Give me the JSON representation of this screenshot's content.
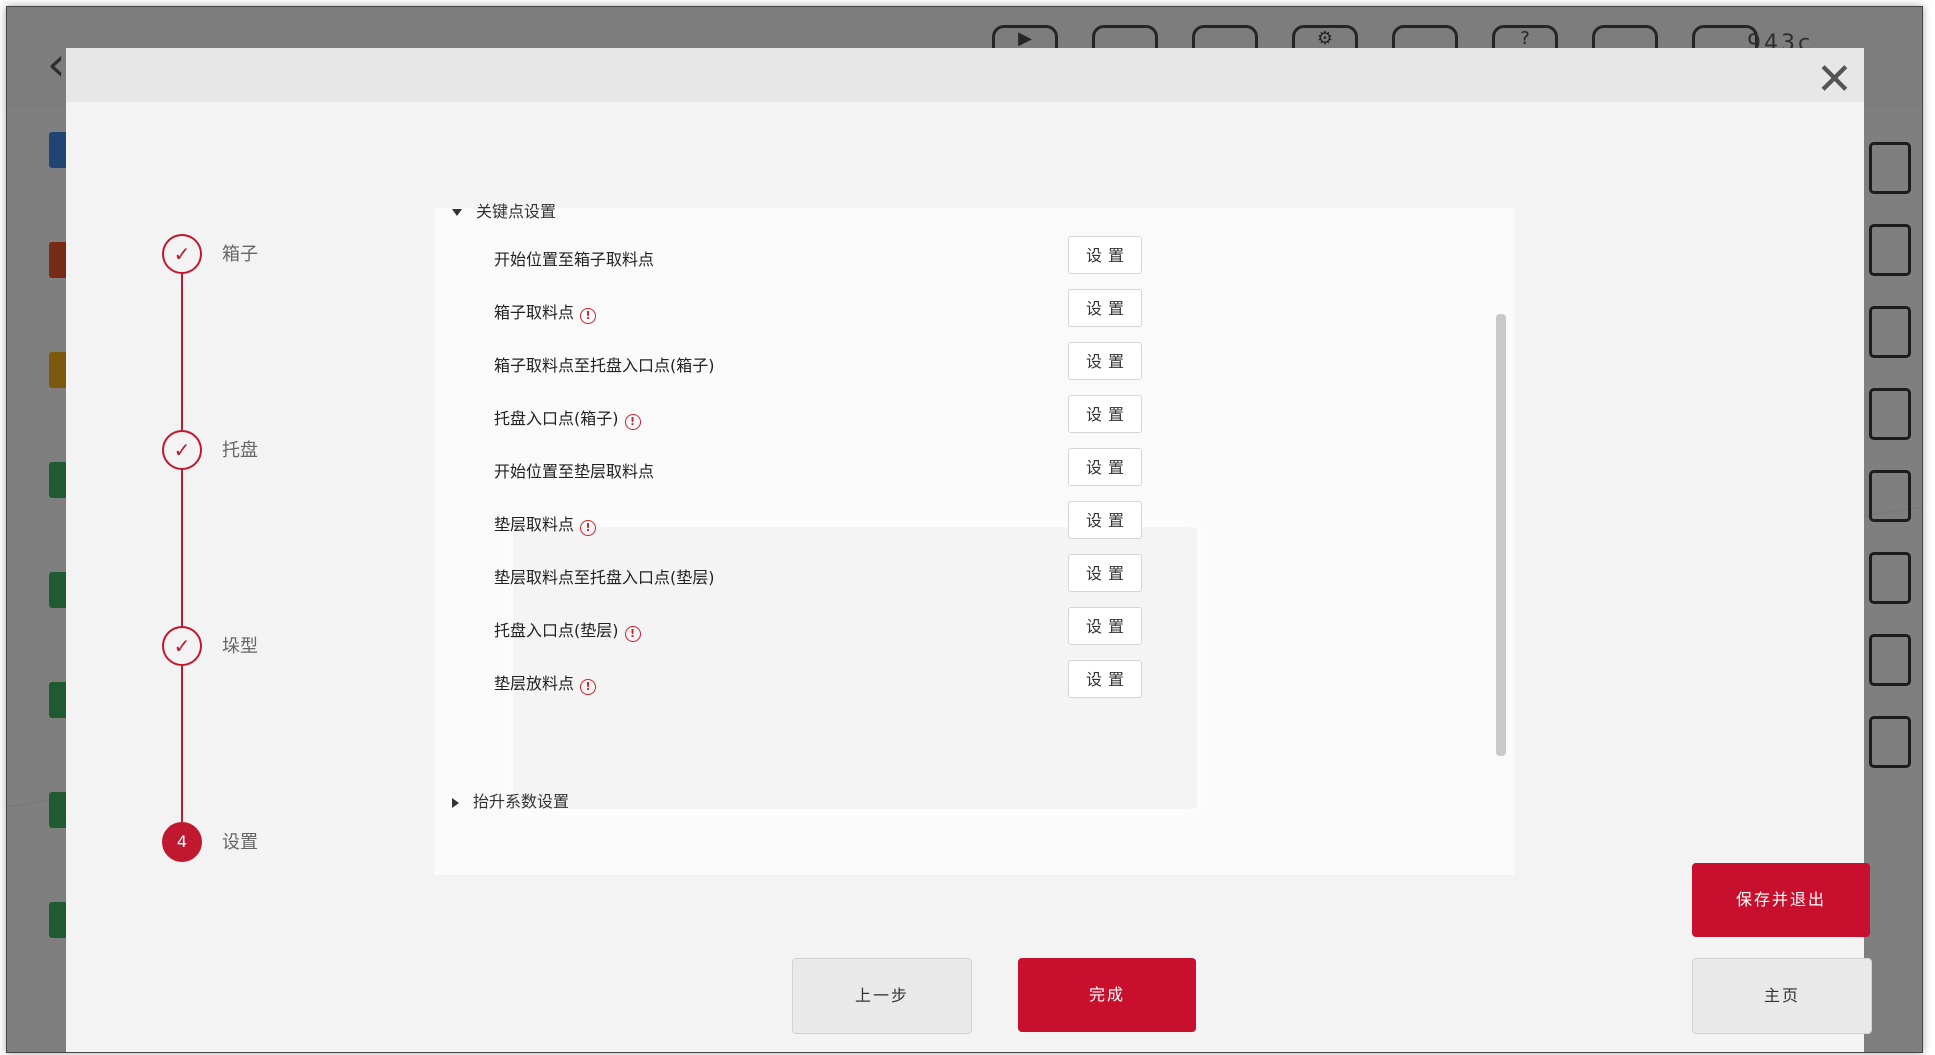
{
  "status_bar": {
    "temperature": "943c"
  },
  "modal": {
    "steps": [
      {
        "label": "箱子",
        "mark": "✓",
        "state": "done"
      },
      {
        "label": "托盘",
        "mark": "✓",
        "state": "done"
      },
      {
        "label": "垛型",
        "mark": "✓",
        "state": "done"
      },
      {
        "label": "设置",
        "mark": "4",
        "state": "current"
      }
    ],
    "sections": {
      "key_points": {
        "title": "关键点设置",
        "rows": [
          {
            "label": "开始位置至箱子取料点",
            "warning": false,
            "button": "设置"
          },
          {
            "label": "箱子取料点",
            "warning": true,
            "button": "设置"
          },
          {
            "label": "箱子取料点至托盘入口点(箱子)",
            "warning": false,
            "button": "设置"
          },
          {
            "label": "托盘入口点(箱子)",
            "warning": true,
            "button": "设置"
          },
          {
            "label": "开始位置至垫层取料点",
            "warning": false,
            "button": "设置"
          },
          {
            "label": "垫层取料点",
            "warning": true,
            "button": "设置"
          },
          {
            "label": "垫层取料点至托盘入口点(垫层)",
            "warning": false,
            "button": "设置"
          },
          {
            "label": "托盘入口点(垫层)",
            "warning": true,
            "button": "设置"
          },
          {
            "label": "垫层放料点",
            "warning": true,
            "button": "设置"
          }
        ]
      },
      "lift_coefficient": {
        "title": "抬升系数设置"
      }
    },
    "buttons": {
      "prev": "上一步",
      "done": "完成",
      "save_exit": "保存并退出",
      "home": "主页"
    }
  },
  "colors": {
    "accent": "#c8102e",
    "warning": "#d21f2c"
  }
}
